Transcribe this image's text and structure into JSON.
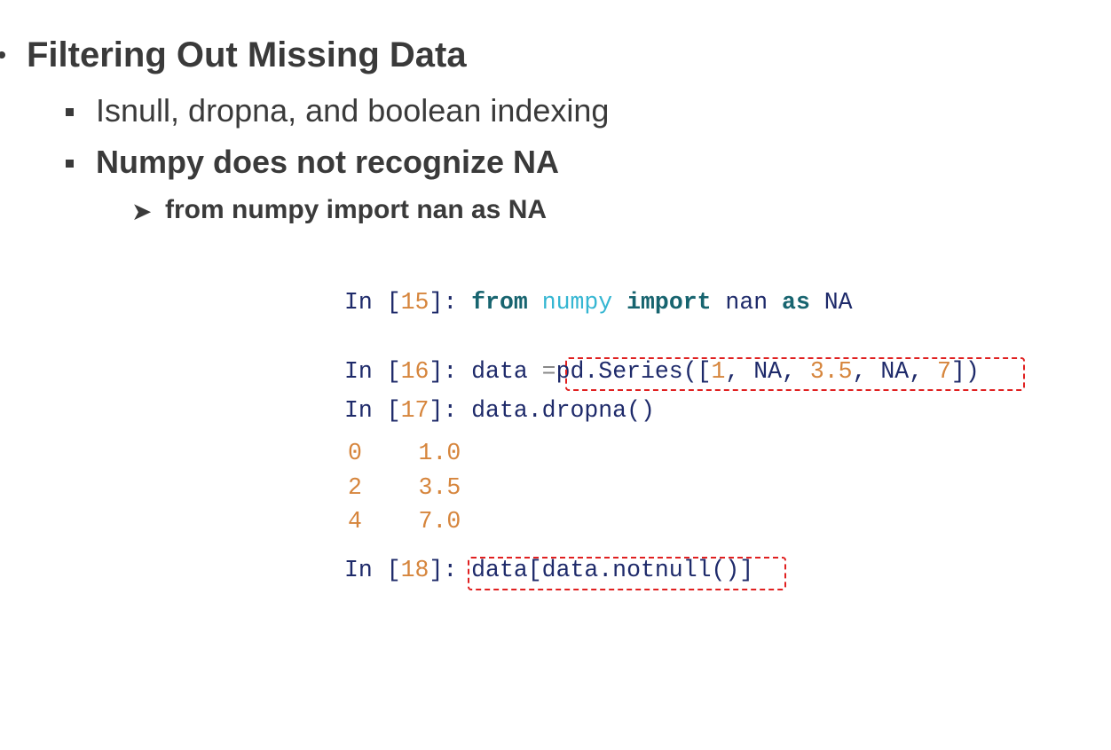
{
  "slide": {
    "heading": "Filtering Out Missing Data",
    "bullets": [
      "Isnull, dropna, and boolean indexing",
      "Numpy does not recognize NA"
    ],
    "sub_bullet": "from numpy import nan as NA"
  },
  "code": {
    "line15": {
      "prompt": "In [",
      "n": "15",
      "close": "]: ",
      "from": "from",
      "sp1": " ",
      "numpy": "numpy",
      "sp2": " ",
      "import": "import",
      "rest1": " nan ",
      "as": "as",
      "rest2": " NA"
    },
    "line16": {
      "prompt": "In [",
      "n": "16",
      "close": "]: ",
      "pre": "data ",
      "eq": "=",
      "call": "pd.Series([",
      "v1": "1",
      ", ": ", ",
      "na1": "NA",
      "c2": ", ",
      "v2": "3.5",
      "c3": ", ",
      "na2": "NA",
      "c4": ", ",
      "v3": "7",
      "end": "])"
    },
    "line17": {
      "prompt": "In [",
      "n": "17",
      "close": "]: ",
      "code": "data.dropna()"
    },
    "output": [
      {
        "index": "0",
        "value": "1.0"
      },
      {
        "index": "2",
        "value": "3.5"
      },
      {
        "index": "4",
        "value": "7.0"
      }
    ],
    "line18": {
      "prompt": "In [",
      "n": "18",
      "close": "]: ",
      "code": "data[data.notnull()]"
    }
  },
  "colors": {
    "highlight_box": "#e02020",
    "keyword": "#17646f",
    "module": "#35b6d2",
    "number": "#d6853c",
    "code_text": "#1e2a6a"
  }
}
